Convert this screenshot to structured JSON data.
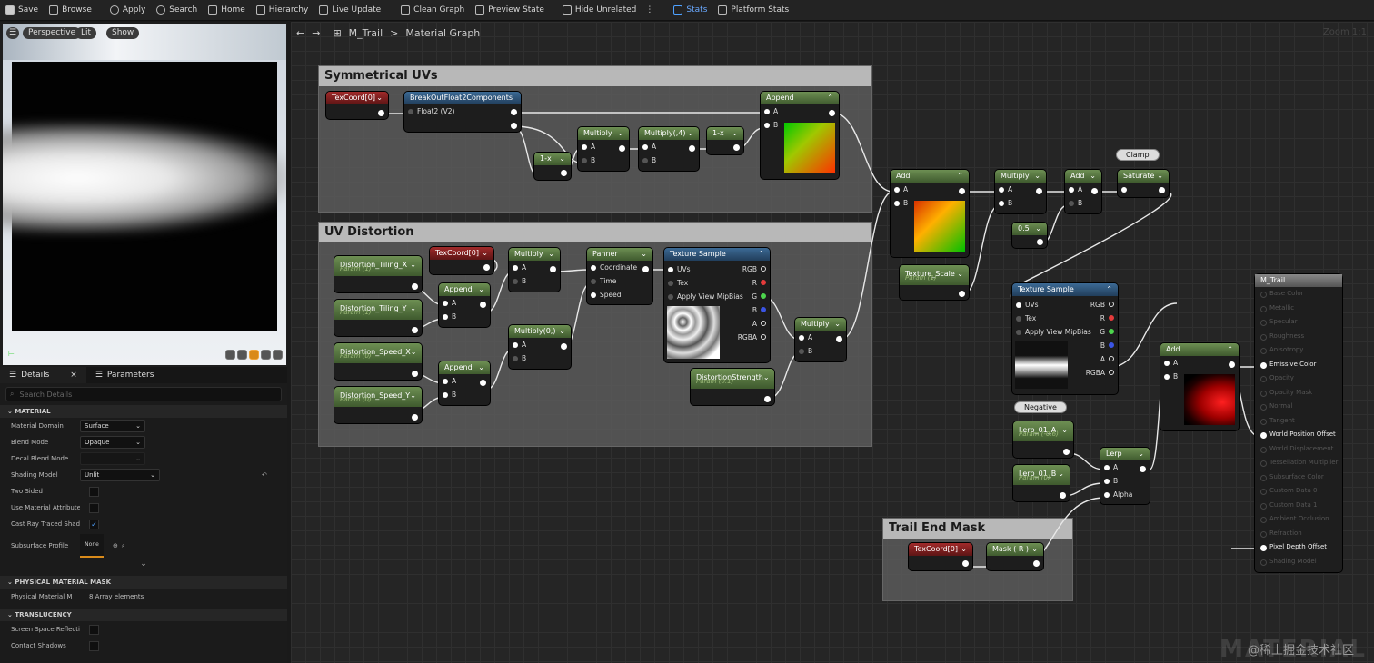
{
  "toolbar": {
    "save": "Save",
    "browse": "Browse",
    "apply": "Apply",
    "search": "Search",
    "home": "Home",
    "hierarchy": "Hierarchy",
    "live_update": "Live Update",
    "clean_graph": "Clean Graph",
    "preview_state": "Preview State",
    "hide_unrelated": "Hide Unrelated",
    "stats": "Stats",
    "platform_stats": "Platform Stats"
  },
  "viewport": {
    "perspective": "Perspective",
    "lit": "Lit",
    "show": "Show"
  },
  "details": {
    "tab_details": "Details",
    "tab_parameters": "Parameters",
    "search_placeholder": "Search Details",
    "sec_material": "MATERIAL",
    "rows": [
      {
        "label": "Material Domain",
        "value": "Surface"
      },
      {
        "label": "Blend Mode",
        "value": "Opaque"
      },
      {
        "label": "Decal Blend Mode",
        "value": ""
      },
      {
        "label": "Shading Model",
        "value": "Unlit"
      },
      {
        "label": "Two Sided",
        "value": ""
      },
      {
        "label": "Use Material Attributes",
        "value": ""
      },
      {
        "label": "Cast Ray Traced Shado",
        "value": ""
      },
      {
        "label": "Subsurface Profile",
        "value": "None"
      }
    ],
    "sec_phys": "PHYSICAL MATERIAL MASK",
    "phys_label": "Physical Material M",
    "phys_value": "8 Array elements",
    "sec_trans": "TRANSLUCENCY",
    "trans_rows": [
      "Screen Space Reflectio",
      "Contact Shadows"
    ]
  },
  "graph": {
    "back": "←",
    "fwd": "→",
    "asset": "M_Trail",
    "sep": ">",
    "title": "Material Graph",
    "zoom": "Zoom 1:1",
    "comments": {
      "sym": "Symmetrical UVs",
      "uvd": "UV Distortion",
      "tem": "Trail End Mask"
    },
    "nodes": {
      "texcoord": "TexCoord[0]",
      "breakout": "BreakOutFloat2Components",
      "float2": "Float2 (V2)",
      "oneminus": "1-x",
      "multiply": "Multiply",
      "multiply4": "Multiply(,4)",
      "append": "Append",
      "add": "Add",
      "saturate": "Saturate",
      "clamp": "Clamp",
      "const05": "0.5",
      "texture_scale": "Texture_Scale",
      "param1": "Param (1)",
      "param0": "Param (0)",
      "param01": "Param (0.1)",
      "param06": "Param (-0.6)",
      "dtx": "Distortion_Tiling_X",
      "dty": "Distortion_Tiling_Y",
      "dsx": "Distortion_Speed_X",
      "dsy": "Distortion_Speed_Y",
      "panner": "Panner",
      "coordinate": "Coordinate",
      "time": "Time",
      "speed": "Speed",
      "texture_sample": "Texture Sample",
      "uvs": "UVs",
      "tex": "Tex",
      "mip": "Apply View MipBias",
      "rgb": "RGB",
      "r": "R",
      "g": "G",
      "b": "B",
      "a": "A",
      "rgba": "RGBA",
      "multiply0": "Multiply(0,)",
      "dstrength": "DistortionStrength",
      "negative": "Negative",
      "lerpa": "Lerp_01_A",
      "lerpb": "Lerp_01_B",
      "lerp": "Lerp",
      "alpha": "Alpha",
      "mask": "Mask ( R )",
      "pa": "A",
      "pb": "B"
    },
    "result": {
      "title": "M_Trail",
      "pins": [
        "Base Color",
        "Metallic",
        "Specular",
        "Roughness",
        "Anisotropy",
        "Emissive Color",
        "Opacity",
        "Opacity Mask",
        "Normal",
        "Tangent",
        "World Position Offset",
        "World Displacement",
        "Tessellation Multiplier",
        "Subsurface Color",
        "Custom Data 0",
        "Custom Data 1",
        "Ambient Occlusion",
        "Refraction",
        "Pixel Depth Offset",
        "Shading Model"
      ]
    }
  },
  "watermark": "@稀土掘金技术社区",
  "watermark2": "MATERIAL"
}
